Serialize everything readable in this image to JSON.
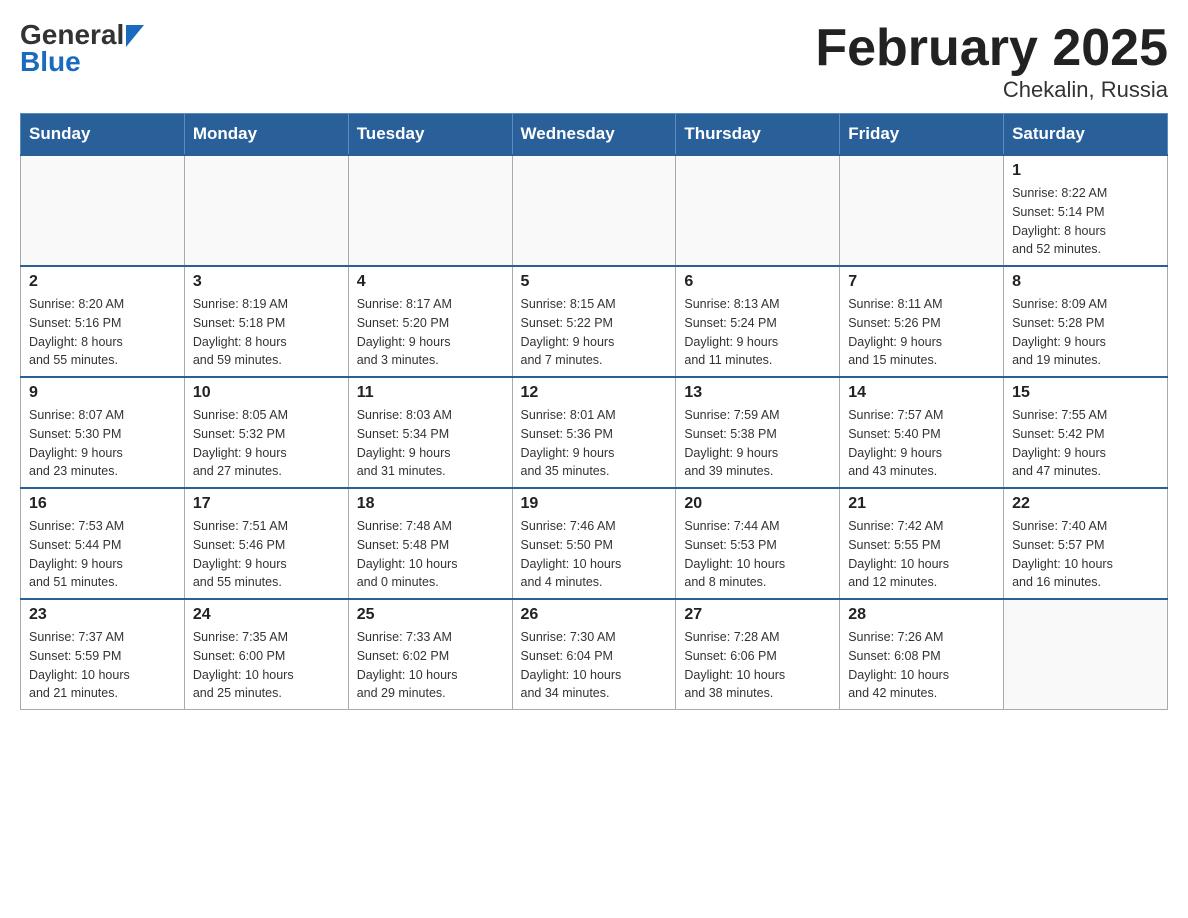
{
  "logo": {
    "general": "General",
    "blue": "Blue"
  },
  "title": "February 2025",
  "location": "Chekalin, Russia",
  "days_of_week": [
    "Sunday",
    "Monday",
    "Tuesday",
    "Wednesday",
    "Thursday",
    "Friday",
    "Saturday"
  ],
  "weeks": [
    [
      {
        "day": "",
        "info": ""
      },
      {
        "day": "",
        "info": ""
      },
      {
        "day": "",
        "info": ""
      },
      {
        "day": "",
        "info": ""
      },
      {
        "day": "",
        "info": ""
      },
      {
        "day": "",
        "info": ""
      },
      {
        "day": "1",
        "info": "Sunrise: 8:22 AM\nSunset: 5:14 PM\nDaylight: 8 hours\nand 52 minutes."
      }
    ],
    [
      {
        "day": "2",
        "info": "Sunrise: 8:20 AM\nSunset: 5:16 PM\nDaylight: 8 hours\nand 55 minutes."
      },
      {
        "day": "3",
        "info": "Sunrise: 8:19 AM\nSunset: 5:18 PM\nDaylight: 8 hours\nand 59 minutes."
      },
      {
        "day": "4",
        "info": "Sunrise: 8:17 AM\nSunset: 5:20 PM\nDaylight: 9 hours\nand 3 minutes."
      },
      {
        "day": "5",
        "info": "Sunrise: 8:15 AM\nSunset: 5:22 PM\nDaylight: 9 hours\nand 7 minutes."
      },
      {
        "day": "6",
        "info": "Sunrise: 8:13 AM\nSunset: 5:24 PM\nDaylight: 9 hours\nand 11 minutes."
      },
      {
        "day": "7",
        "info": "Sunrise: 8:11 AM\nSunset: 5:26 PM\nDaylight: 9 hours\nand 15 minutes."
      },
      {
        "day": "8",
        "info": "Sunrise: 8:09 AM\nSunset: 5:28 PM\nDaylight: 9 hours\nand 19 minutes."
      }
    ],
    [
      {
        "day": "9",
        "info": "Sunrise: 8:07 AM\nSunset: 5:30 PM\nDaylight: 9 hours\nand 23 minutes."
      },
      {
        "day": "10",
        "info": "Sunrise: 8:05 AM\nSunset: 5:32 PM\nDaylight: 9 hours\nand 27 minutes."
      },
      {
        "day": "11",
        "info": "Sunrise: 8:03 AM\nSunset: 5:34 PM\nDaylight: 9 hours\nand 31 minutes."
      },
      {
        "day": "12",
        "info": "Sunrise: 8:01 AM\nSunset: 5:36 PM\nDaylight: 9 hours\nand 35 minutes."
      },
      {
        "day": "13",
        "info": "Sunrise: 7:59 AM\nSunset: 5:38 PM\nDaylight: 9 hours\nand 39 minutes."
      },
      {
        "day": "14",
        "info": "Sunrise: 7:57 AM\nSunset: 5:40 PM\nDaylight: 9 hours\nand 43 minutes."
      },
      {
        "day": "15",
        "info": "Sunrise: 7:55 AM\nSunset: 5:42 PM\nDaylight: 9 hours\nand 47 minutes."
      }
    ],
    [
      {
        "day": "16",
        "info": "Sunrise: 7:53 AM\nSunset: 5:44 PM\nDaylight: 9 hours\nand 51 minutes."
      },
      {
        "day": "17",
        "info": "Sunrise: 7:51 AM\nSunset: 5:46 PM\nDaylight: 9 hours\nand 55 minutes."
      },
      {
        "day": "18",
        "info": "Sunrise: 7:48 AM\nSunset: 5:48 PM\nDaylight: 10 hours\nand 0 minutes."
      },
      {
        "day": "19",
        "info": "Sunrise: 7:46 AM\nSunset: 5:50 PM\nDaylight: 10 hours\nand 4 minutes."
      },
      {
        "day": "20",
        "info": "Sunrise: 7:44 AM\nSunset: 5:53 PM\nDaylight: 10 hours\nand 8 minutes."
      },
      {
        "day": "21",
        "info": "Sunrise: 7:42 AM\nSunset: 5:55 PM\nDaylight: 10 hours\nand 12 minutes."
      },
      {
        "day": "22",
        "info": "Sunrise: 7:40 AM\nSunset: 5:57 PM\nDaylight: 10 hours\nand 16 minutes."
      }
    ],
    [
      {
        "day": "23",
        "info": "Sunrise: 7:37 AM\nSunset: 5:59 PM\nDaylight: 10 hours\nand 21 minutes."
      },
      {
        "day": "24",
        "info": "Sunrise: 7:35 AM\nSunset: 6:00 PM\nDaylight: 10 hours\nand 25 minutes."
      },
      {
        "day": "25",
        "info": "Sunrise: 7:33 AM\nSunset: 6:02 PM\nDaylight: 10 hours\nand 29 minutes."
      },
      {
        "day": "26",
        "info": "Sunrise: 7:30 AM\nSunset: 6:04 PM\nDaylight: 10 hours\nand 34 minutes."
      },
      {
        "day": "27",
        "info": "Sunrise: 7:28 AM\nSunset: 6:06 PM\nDaylight: 10 hours\nand 38 minutes."
      },
      {
        "day": "28",
        "info": "Sunrise: 7:26 AM\nSunset: 6:08 PM\nDaylight: 10 hours\nand 42 minutes."
      },
      {
        "day": "",
        "info": ""
      }
    ]
  ]
}
